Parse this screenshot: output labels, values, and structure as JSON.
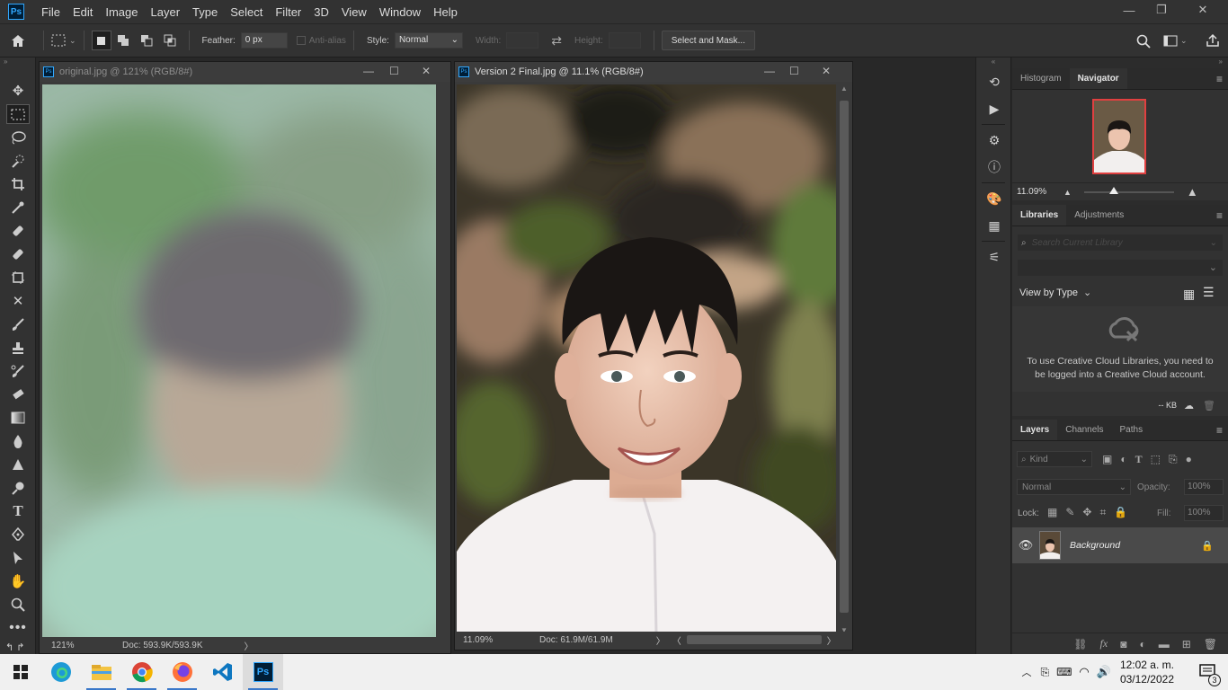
{
  "app": {
    "logo": "Ps"
  },
  "menu": [
    "File",
    "Edit",
    "Image",
    "Layer",
    "Type",
    "Select",
    "Filter",
    "3D",
    "View",
    "Window",
    "Help"
  ],
  "window_controls": {
    "minimize": "—",
    "restore": "❐",
    "close": "✕"
  },
  "options": {
    "feather_label": "Feather:",
    "feather_value": "0 px",
    "antialias_label": "Anti-alias",
    "style_label": "Style:",
    "style_value": "Normal",
    "width_label": "Width:",
    "height_label": "Height:",
    "select_mask": "Select and Mask..."
  },
  "doc1": {
    "title": "original.jpg @ 121% (RGB/8#)",
    "zoom": "121%",
    "doc_size": "Doc: 593.9K/593.9K"
  },
  "doc2": {
    "title": "Version 2 Final.jpg @ 11.1% (RGB/8#)",
    "zoom": "11.09%",
    "doc_size": "Doc: 61.9M/61.9M"
  },
  "navigator": {
    "tabs": [
      "Histogram",
      "Navigator"
    ],
    "zoom": "11.09%"
  },
  "libraries": {
    "tabs": [
      "Libraries",
      "Adjustments"
    ],
    "search_placeholder": "Search Current Library",
    "view_by": "View by Type",
    "message": "To use Creative Cloud Libraries, you need to be logged into a Creative Cloud account.",
    "kb": "-- KB"
  },
  "layers": {
    "tabs": [
      "Layers",
      "Channels",
      "Paths"
    ],
    "kind_label": "Kind",
    "blend_mode": "Normal",
    "opacity_label": "Opacity:",
    "opacity_value": "100%",
    "lock_label": "Lock:",
    "fill_label": "Fill:",
    "fill_value": "100%",
    "layer_name": "Background"
  },
  "taskbar": {
    "time": "12:02 a. m.",
    "date": "03/12/2022",
    "notifications": "3",
    "ps_label": "Ps"
  },
  "colors": {
    "accent": "#31a8ff",
    "ui_dark": "#323232",
    "canvas": "#282828"
  }
}
